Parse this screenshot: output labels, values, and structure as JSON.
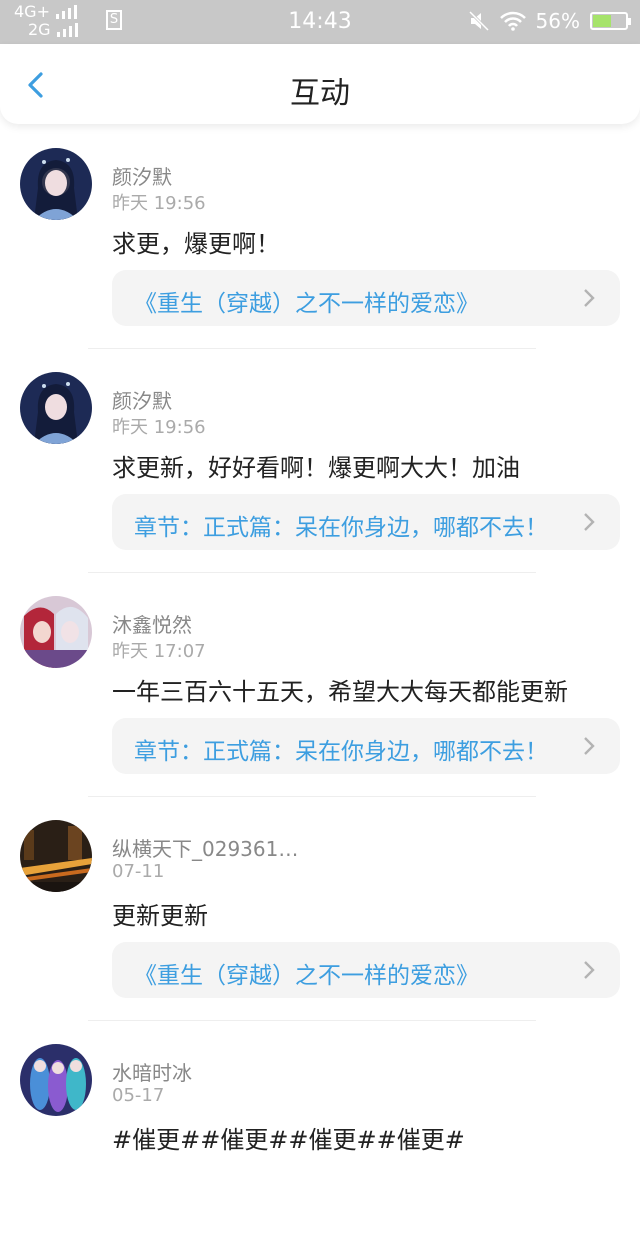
{
  "status_bar": {
    "network_top": "4G+",
    "network_bottom": "2G",
    "time": "14:43",
    "battery": "56%",
    "battery_level": 0.56
  },
  "header": {
    "title": "互动"
  },
  "comments": [
    {
      "user": "颜汐默",
      "time": "昨天 19:56",
      "text": "求更，爆更啊！",
      "link": "《重生（穿越）之不一样的爱恋》"
    },
    {
      "user": "颜汐默",
      "time": "昨天 19:56",
      "text": "求更新，好好看啊！爆更啊大大！加油",
      "link": "章节：正式篇：呆在你身边，哪都不去！"
    },
    {
      "user": "沐鑫悦然",
      "time": "昨天 17:07",
      "text": "一年三百六十五天，希望大大每天都能更新",
      "link": "章节：正式篇：呆在你身边，哪都不去！"
    },
    {
      "user": "纵横天下_029361…",
      "time": "07-11",
      "text": "更新更新",
      "link": "《重生（穿越）之不一样的爱恋》"
    },
    {
      "user": "水暗时冰",
      "time": "05-17",
      "text": "#催更##催更##催更##催更#",
      "link": ""
    }
  ],
  "colors": {
    "accent": "#3d9ee0",
    "status_bar": "#c8c8c8",
    "link_bg": "#f4f4f4"
  }
}
